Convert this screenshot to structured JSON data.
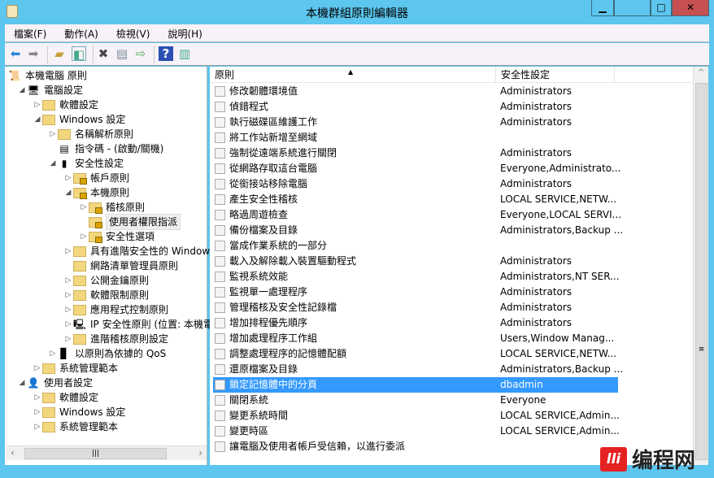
{
  "window": {
    "title": "本機群組原則編輯器",
    "minimize": "▁",
    "maximize": "□",
    "close": "✕"
  },
  "menu": [
    "檔案(F)",
    "動作(A)",
    "檢視(V)",
    "說明(H)"
  ],
  "tree": [
    {
      "label": "本機電腦 原則",
      "level": 0,
      "exp": "",
      "icon": "policy-scroll-icon"
    },
    {
      "label": "電腦設定",
      "level": 1,
      "exp": "◢",
      "icon": "computer-icon"
    },
    {
      "label": "軟體設定",
      "level": 2,
      "exp": "▷",
      "icon": "folder-icon"
    },
    {
      "label": "Windows 設定",
      "level": 2,
      "exp": "◢",
      "icon": "folder-icon"
    },
    {
      "label": "名稱解析原則",
      "level": 3,
      "exp": "▷",
      "icon": "folder-icon"
    },
    {
      "label": "指令碼 - (啟動/關機)",
      "level": 3,
      "exp": "",
      "icon": "script-icon"
    },
    {
      "label": "安全性設定",
      "level": 3,
      "exp": "◢",
      "icon": "security-server-icon"
    },
    {
      "label": "帳戶原則",
      "level": 4,
      "exp": "▷",
      "icon": "locked-folder-icon"
    },
    {
      "label": "本機原則",
      "level": 4,
      "exp": "◢",
      "icon": "locked-folder-icon"
    },
    {
      "label": "稽核原則",
      "level": 5,
      "exp": "▷",
      "icon": "locked-folder-icon"
    },
    {
      "label": "使用者權限指派",
      "level": 5,
      "exp": "",
      "icon": "locked-folder-icon",
      "selected": true
    },
    {
      "label": "安全性選項",
      "level": 5,
      "exp": "▷",
      "icon": "locked-folder-icon"
    },
    {
      "label": "具有進階安全性的 Windows",
      "level": 4,
      "exp": "▷",
      "icon": "folder-icon"
    },
    {
      "label": "網路清單管理員原則",
      "level": 4,
      "exp": "",
      "icon": "folder-icon"
    },
    {
      "label": "公開金鑰原則",
      "level": 4,
      "exp": "▷",
      "icon": "folder-icon"
    },
    {
      "label": "軟體限制原則",
      "level": 4,
      "exp": "▷",
      "icon": "folder-icon"
    },
    {
      "label": "應用程式控制原則",
      "level": 4,
      "exp": "▷",
      "icon": "folder-icon"
    },
    {
      "label": "IP 安全性原則 (位置: 本機電",
      "level": 4,
      "exp": "▷",
      "icon": "ip-security-icon"
    },
    {
      "label": "進階稽核原則設定",
      "level": 4,
      "exp": "▷",
      "icon": "folder-icon"
    },
    {
      "label": "以原則為依據的 QoS",
      "level": 3,
      "exp": "▷",
      "icon": "qos-chart-icon"
    },
    {
      "label": "系統管理範本",
      "level": 2,
      "exp": "▷",
      "icon": "folder-icon"
    },
    {
      "label": "使用者設定",
      "level": 1,
      "exp": "◢",
      "icon": "user-icon"
    },
    {
      "label": "軟體設定",
      "level": 2,
      "exp": "▷",
      "icon": "folder-icon"
    },
    {
      "label": "Windows 設定",
      "level": 2,
      "exp": "▷",
      "icon": "folder-icon"
    },
    {
      "label": "系統管理範本",
      "level": 2,
      "exp": "▷",
      "icon": "folder-icon"
    }
  ],
  "list": {
    "columns": [
      "原則",
      "安全性設定"
    ],
    "sort_indicator": "▲",
    "rows": [
      [
        "修改韌體環境值",
        "Administrators"
      ],
      [
        "偵錯程式",
        "Administrators"
      ],
      [
        "執行磁碟區維護工作",
        "Administrators"
      ],
      [
        "將工作站新增至網域",
        ""
      ],
      [
        "強制從遠端系統進行關閉",
        "Administrators"
      ],
      [
        "從網路存取這台電腦",
        "Everyone,Administrato..."
      ],
      [
        "從銜接站移除電腦",
        "Administrators"
      ],
      [
        "產生安全性稽核",
        "LOCAL SERVICE,NETW..."
      ],
      [
        "略過周遊檢查",
        "Everyone,LOCAL SERVI..."
      ],
      [
        "備份檔案及目錄",
        "Administrators,Backup ..."
      ],
      [
        "當成作業系統的一部分",
        ""
      ],
      [
        "載入及解除載入裝置驅動程式",
        "Administrators"
      ],
      [
        "監視系統效能",
        "Administrators,NT SER..."
      ],
      [
        "監視單一處理程序",
        "Administrators"
      ],
      [
        "管理稽核及安全性記錄檔",
        "Administrators"
      ],
      [
        "增加排程優先順序",
        "Administrators"
      ],
      [
        "增加處理程序工作組",
        "Users,Window Manag..."
      ],
      [
        "調整處理程序的記憶體配額",
        "LOCAL SERVICE,NETW..."
      ],
      [
        "還原檔案及目錄",
        "Administrators,Backup ..."
      ],
      [
        "鎖定記憶體中的分頁",
        "dbadmin"
      ],
      [
        "關閉系統",
        "Everyone"
      ],
      [
        "變更系統時間",
        "LOCAL SERVICE,Admin..."
      ],
      [
        "變更時區",
        "LOCAL SERVICE,Admin..."
      ],
      [
        "讓電腦及使用者帳戶受信賴，以進行委派",
        ""
      ]
    ],
    "selected_index": 19
  },
  "watermark": {
    "logo": "lli",
    "text": "编程网"
  },
  "colors": {
    "titlebar": "#5cc6ee",
    "selection": "#3399ff",
    "close": "#c75050"
  }
}
